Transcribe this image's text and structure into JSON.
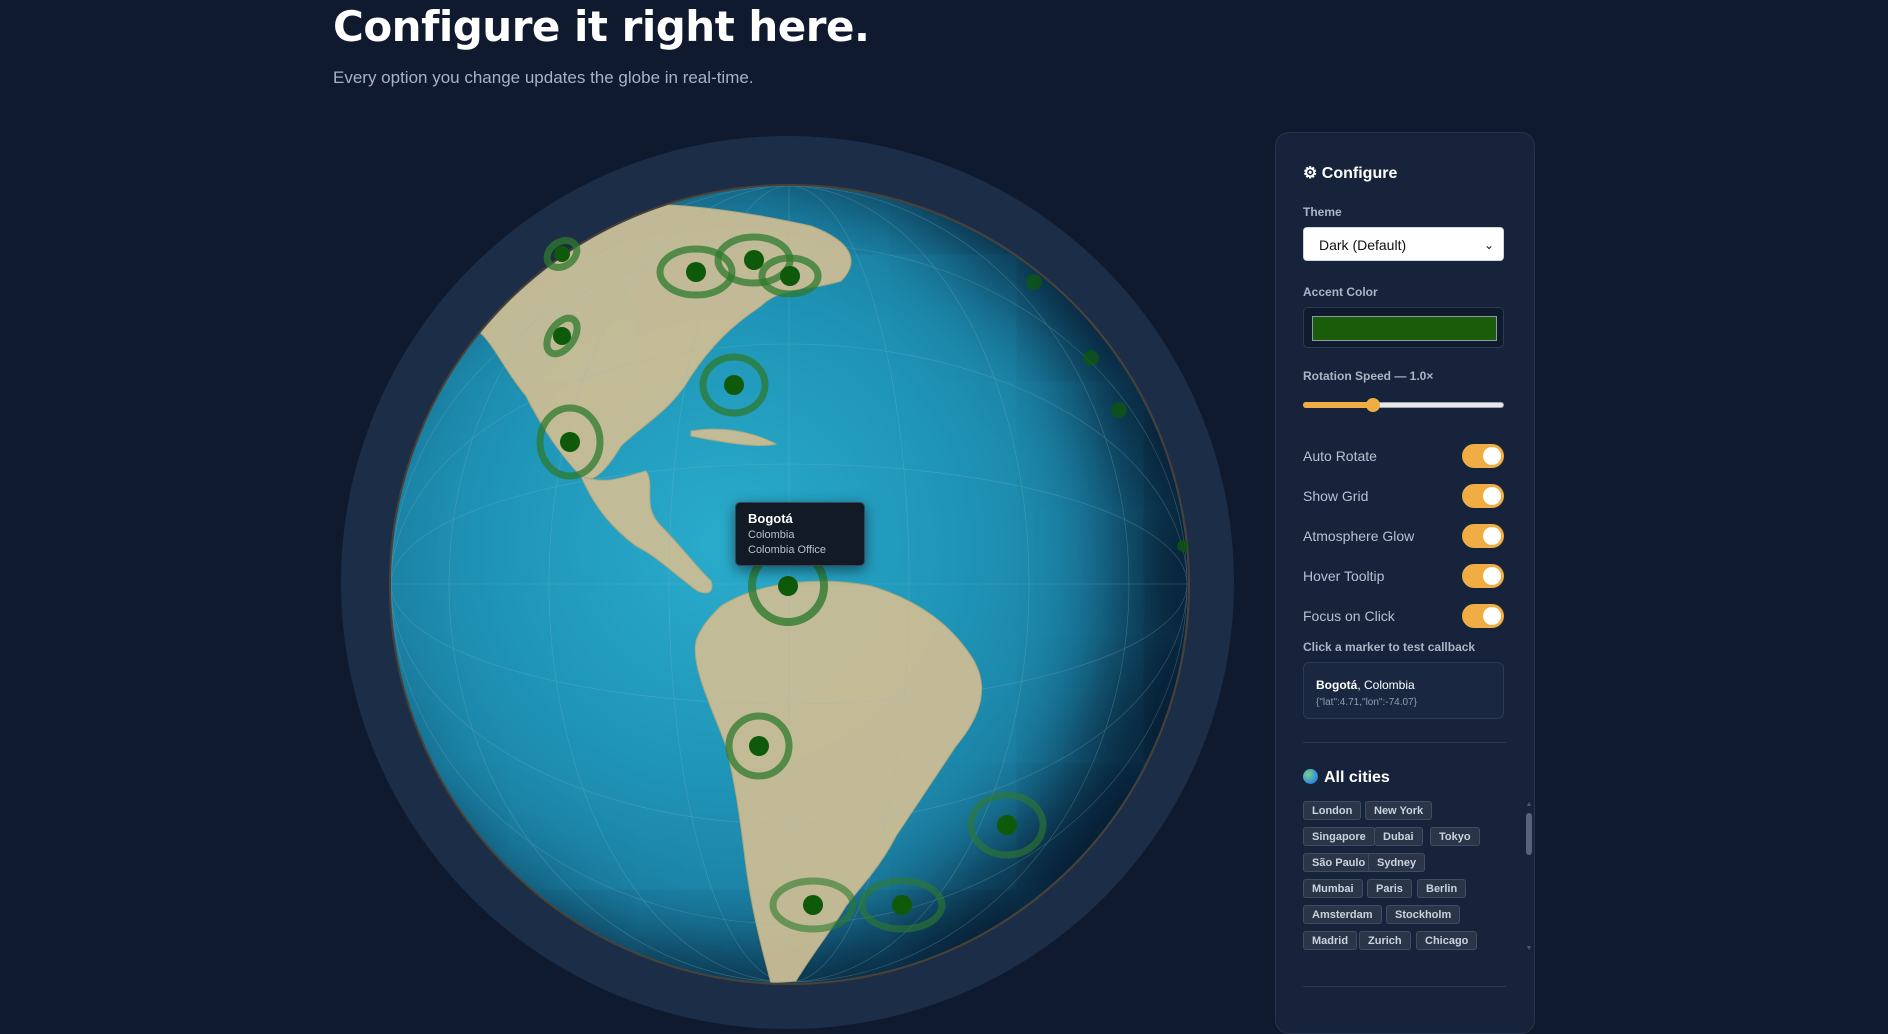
{
  "header": {
    "title": "Configure it right here.",
    "subtitle": "Every option you change updates the globe in real-time."
  },
  "tooltip": {
    "city": "Bogotá",
    "country": "Colombia",
    "office": "Colombia Office"
  },
  "panel": {
    "title": "⚙ Configure",
    "theme_label": "Theme",
    "theme_value": "Dark (Default)",
    "accent_label": "Accent Color",
    "accent_color": "#1a5c0a",
    "rotation_label": "Rotation Speed — 1.0×",
    "rotation_fraction": 0.35,
    "toggles": [
      {
        "label": "Auto Rotate",
        "on": true
      },
      {
        "label": "Show Grid",
        "on": true
      },
      {
        "label": "Atmosphere Glow",
        "on": true
      },
      {
        "label": "Hover Tooltip",
        "on": true
      },
      {
        "label": "Focus on Click",
        "on": true
      }
    ],
    "callback_label": "Click a marker to test callback",
    "callback_city": "Bogotá",
    "callback_country": ", Colombia",
    "callback_coords": "{\"lat\":4.71,\"lon\":-74.07}",
    "cities_title": "All cities",
    "cities": [
      "London",
      "New York",
      "Singapore",
      "Dubai",
      "Tokyo",
      "São Paulo",
      "Sydney",
      "Mumbai",
      "Paris",
      "Berlin",
      "Amsterdam",
      "Stockholm",
      "Madrid",
      "Zurich",
      "Chicago"
    ]
  },
  "colors": {
    "accent": "#f0ad43",
    "marker": "#0e5a0a",
    "background": "#0f1a2e"
  }
}
